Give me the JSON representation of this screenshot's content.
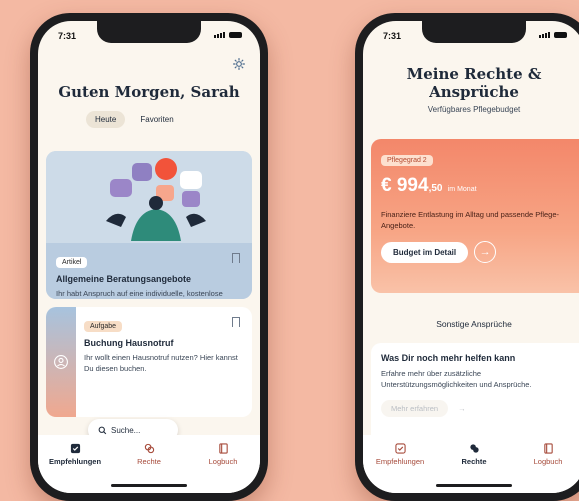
{
  "left": {
    "time": "7:31",
    "greeting": "Guten Morgen, Sarah",
    "segments": {
      "today": "Heute",
      "favorites": "Favoriten"
    },
    "card1": {
      "chip": "Artikel",
      "title": "Allgemeine Beratungsangebote",
      "desc": "Ihr habt Anspruch auf eine individuelle, kostenlose Beratung."
    },
    "card2": {
      "chip": "Aufgabe",
      "title": "Buchung Hausnotruf",
      "desc": "Ihr wollt einen Hausnotruf nutzen? Hier kannst Du diesen buchen."
    },
    "search": {
      "label": "Suche..."
    },
    "tabs": {
      "recommendations": "Empfehlungen",
      "rights": "Rechte",
      "logbook": "Logbuch"
    }
  },
  "right": {
    "time": "7:31",
    "title_line1": "Meine Rechte &",
    "title_line2": "Ansprüche",
    "subtitle": "Verfügbares Pflegebudget",
    "budget": {
      "chip": "Pflegegrad 2",
      "currency": "€",
      "amount_main": "994",
      "amount_decimals": ",50",
      "unit": "im Monat",
      "desc": "Finanziere Entlastung im Alltag und passende Pflege-Angebote.",
      "button": "Budget im Detail"
    },
    "section": "Sonstige Ansprüche",
    "card": {
      "title": "Was Dir noch mehr helfen kann",
      "desc": "Erfahre mehr über zusätzliche Unterstützungsmöglichkeiten und Ansprüche.",
      "ghost": "Mehr erfahren"
    },
    "tabs": {
      "recommendations": "Empfehlungen",
      "rights": "Rechte",
      "logbook": "Logbuch"
    }
  },
  "colors": {
    "background": "#f4b9a3",
    "accent": "#f3876a",
    "navy": "#1f2a3a",
    "card_blue": "#cddbe8"
  }
}
